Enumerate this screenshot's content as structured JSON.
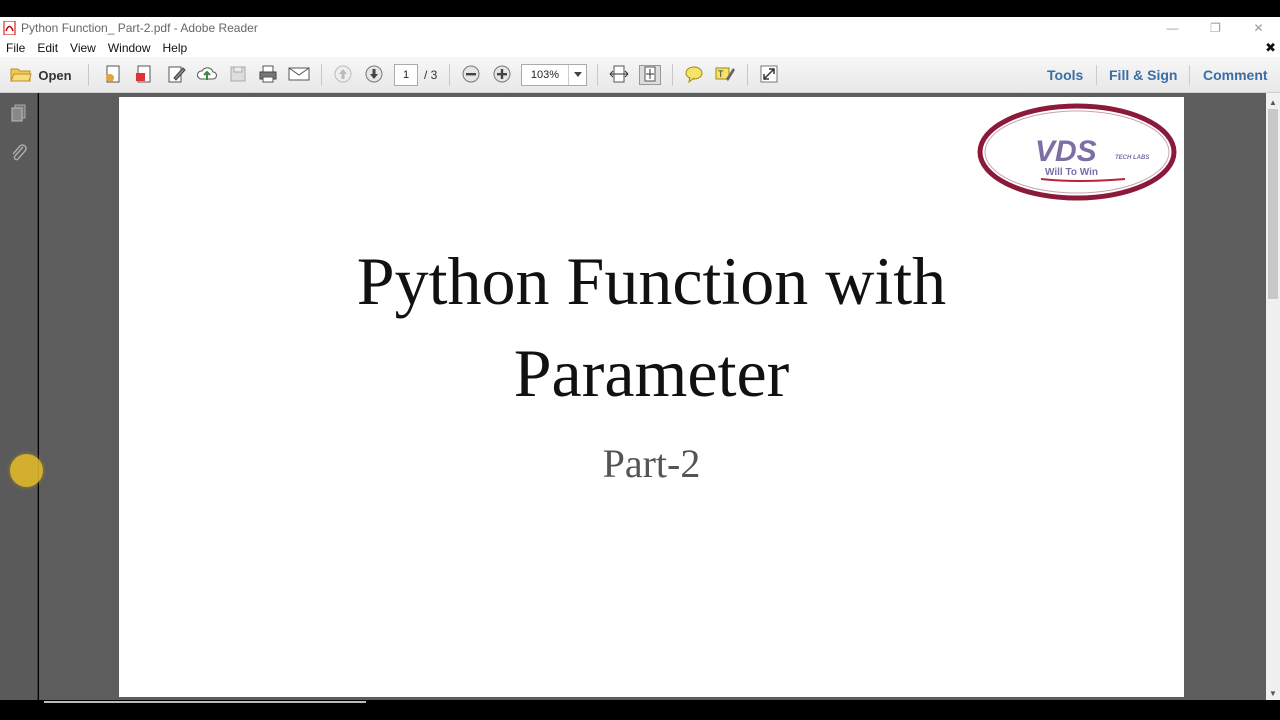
{
  "window": {
    "title": "Python Function_ Part-2.pdf - Adobe Reader",
    "controls": {
      "minimize": "—",
      "restore": "❐",
      "close": "✕"
    }
  },
  "menu": {
    "items": [
      "File",
      "Edit",
      "View",
      "Window",
      "Help"
    ],
    "close_glyph": "✖"
  },
  "toolbar": {
    "open_label": "Open",
    "page_current": "1",
    "page_total": "/ 3",
    "zoom": "103%",
    "tabs": [
      "Tools",
      "Fill & Sign",
      "Comment"
    ]
  },
  "document": {
    "title_line1": "Python Function with",
    "title_line2": "Parameter",
    "subtitle": "Part-2",
    "logo": {
      "brand": "VDS",
      "tagline_small": "TECH LABS",
      "slogan": "Will To Win"
    }
  },
  "colors": {
    "accent_link": "#3a6ea5",
    "logo_ring": "#8b1a3a",
    "logo_text": "#7b6fa6",
    "cursor_highlight": "#e8be28"
  }
}
